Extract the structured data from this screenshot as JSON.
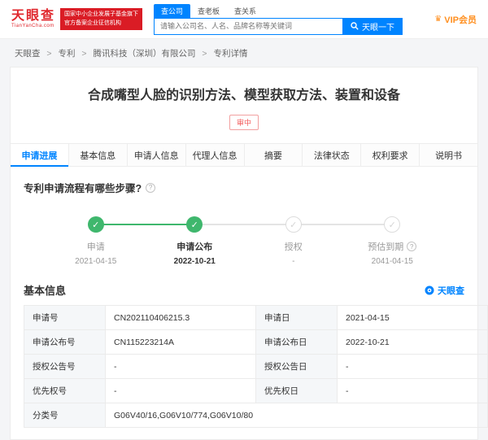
{
  "header": {
    "logo_title": "天眼查",
    "logo_subtitle": "TianYanCha.com",
    "ribbon_line1": "国家中小企业发展子基金旗下",
    "ribbon_line2": "官方备案企业征信机构",
    "search_tabs": [
      {
        "label": "查公司"
      },
      {
        "label": "查老板"
      },
      {
        "label": "查关系"
      }
    ],
    "search_placeholder": "请输入公司名、人名、品牌名称等关键词",
    "search_button": "天眼一下",
    "vip_link": "VIP会员"
  },
  "breadcrumb": {
    "separator": ">",
    "items": [
      {
        "label": "天眼查"
      },
      {
        "label": "专利"
      },
      {
        "label": "腾讯科技（深圳）有限公司"
      },
      {
        "label": "专利详情"
      }
    ]
  },
  "patent": {
    "title": "合成嘴型人脸的识别方法、模型获取方法、装置和设备",
    "status_badge": "审中"
  },
  "tabs": [
    {
      "label": "申请进展"
    },
    {
      "label": "基本信息"
    },
    {
      "label": "申请人信息"
    },
    {
      "label": "代理人信息"
    },
    {
      "label": "摘要"
    },
    {
      "label": "法律状态"
    },
    {
      "label": "权利要求"
    },
    {
      "label": "说明书"
    }
  ],
  "progress_section": {
    "heading": "专利申请流程有哪些步骤?",
    "steps": [
      {
        "label": "申请",
        "date": "2021-04-15",
        "state": "done"
      },
      {
        "label": "申请公布",
        "date": "2022-10-21",
        "state": "current"
      },
      {
        "label": "授权",
        "date": "-",
        "state": "pending"
      },
      {
        "label": "预估到期",
        "date": "2041-04-15",
        "state": "pending"
      }
    ]
  },
  "basic_info": {
    "heading": "基本信息",
    "watermark": "天眼查",
    "rows": [
      [
        {
          "label": "申请号",
          "value": "CN202110406215.3"
        },
        {
          "label": "申请日",
          "value": "2021-04-15"
        }
      ],
      [
        {
          "label": "申请公布号",
          "value": "CN115223214A"
        },
        {
          "label": "申请公布日",
          "value": "2022-10-21"
        }
      ],
      [
        {
          "label": "授权公告号",
          "value": "-"
        },
        {
          "label": "授权公告日",
          "value": "-"
        }
      ],
      [
        {
          "label": "优先权号",
          "value": "-"
        },
        {
          "label": "优先权日",
          "value": "-"
        }
      ]
    ],
    "class_row": {
      "label": "分类号",
      "value": "G06V40/16,G06V10/774,G06V10/80"
    }
  },
  "icons": {
    "check": "✓",
    "question": "?",
    "crown": "♛"
  },
  "colors": {
    "brand_blue": "#0084ff",
    "logo_red": "#e0282e",
    "ribbon_red": "#da1c25",
    "vip_orange": "#ff8f1f",
    "status_red": "#f25a5a",
    "step_green": "#3fb76d"
  }
}
